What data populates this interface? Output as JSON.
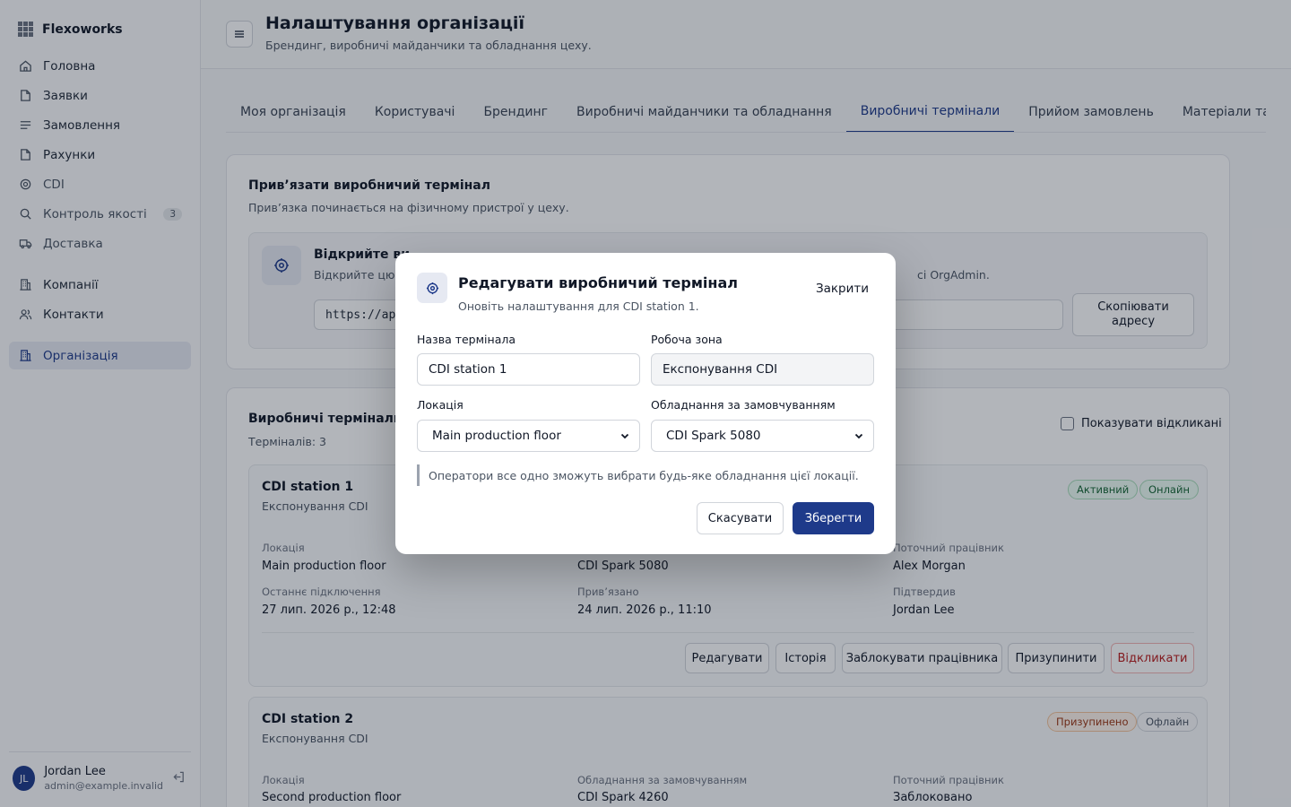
{
  "app": {
    "name": "Flexoworks"
  },
  "sidebar": {
    "items": [
      {
        "label": "Головна",
        "icon": "home-icon"
      },
      {
        "label": "Заявки",
        "icon": "file-icon"
      },
      {
        "label": "Замовлення",
        "icon": "list-icon"
      },
      {
        "label": "Рахунки",
        "icon": "file-icon"
      },
      {
        "label": "CDI",
        "icon": "target-icon"
      },
      {
        "label": "Контроль якості",
        "icon": "search-icon",
        "count": "3"
      },
      {
        "label": "Доставка",
        "icon": "truck-icon"
      },
      {
        "label": "Компанії",
        "icon": "building-icon"
      },
      {
        "label": "Контакти",
        "icon": "users-icon"
      },
      {
        "label": "Організація",
        "icon": "building-icon",
        "active": true
      }
    ],
    "user": {
      "initials": "JL",
      "name": "Jordan Lee",
      "email": "admin@example.invalid"
    }
  },
  "header": {
    "title": "Налаштування організації",
    "subtitle": "Брендинг, виробничі майданчики та обладнання цеху."
  },
  "tabs": [
    "Моя організація",
    "Користувачі",
    "Брендинг",
    "Виробничі майданчики та обладнання",
    "Виробничі термінали",
    "Прийом замовлень",
    "Матеріали та по"
  ],
  "link_card": {
    "title": "Прив’язати виробничий термінал",
    "subtitle": "Прив’язка починається на фізичному пристрої у цеху.",
    "box_title": "Відкрийте ви",
    "box_text": "Відкрийте цю а",
    "box_text_tail": "сі OrgAdmin.",
    "url": "https://app",
    "copy_label": "Скопіювати адресу"
  },
  "terminals_card": {
    "title": "Виробничі термінали",
    "count": "Терміналів: 3",
    "show_revoked": "Показувати відкликані",
    "labels": {
      "location": "Локація",
      "equipment": "Обладнання за замовчуванням",
      "operator": "Поточний працівник",
      "last_connected": "Останнє підключення",
      "linked": "Прив’язано",
      "confirmed_by": "Підтвердив"
    },
    "actions": {
      "edit": "Редагувати",
      "history": "Історія",
      "block": "Заблокувати працівника",
      "pause": "Призупинити",
      "revoke": "Відкликати"
    },
    "items": [
      {
        "name": "CDI station 1",
        "zone": "Експонування CDI",
        "status": "Активний",
        "connection": "Онлайн",
        "location": "Main production floor",
        "equipment": "CDI Spark 5080",
        "operator": "Alex Morgan",
        "last_connected": "27 лип. 2026 р., 12:48",
        "linked": "24 лип. 2026 р., 11:10",
        "confirmed_by": "Jordan Lee"
      },
      {
        "name": "CDI station 2",
        "zone": "Експонування CDI",
        "status": "Призупинено",
        "connection": "Офлайн",
        "location": "Second production floor",
        "equipment": "CDI Spark 4260",
        "operator": "Заблоковано"
      }
    ]
  },
  "modal": {
    "title": "Редагувати виробничий термінал",
    "subtitle": "Оновіть налаштування для CDI station 1.",
    "close": "Закрити",
    "name_label": "Назва термінала",
    "name_value": "CDI station 1",
    "zone_label": "Робоча зона",
    "zone_value": "Експонування CDI",
    "location_label": "Локація",
    "location_value": "Main production floor",
    "equipment_label": "Обладнання за замовчуванням",
    "equipment_value": "CDI Spark 5080",
    "hint": "Оператори все одно зможуть вибрати будь-яке обладнання цієї локації.",
    "cancel": "Скасувати",
    "save": "Зберегти"
  },
  "colors": {
    "accent": "#1e3a8a",
    "success": "#166534",
    "warning": "#9a3412",
    "danger": "#b91c1c"
  }
}
